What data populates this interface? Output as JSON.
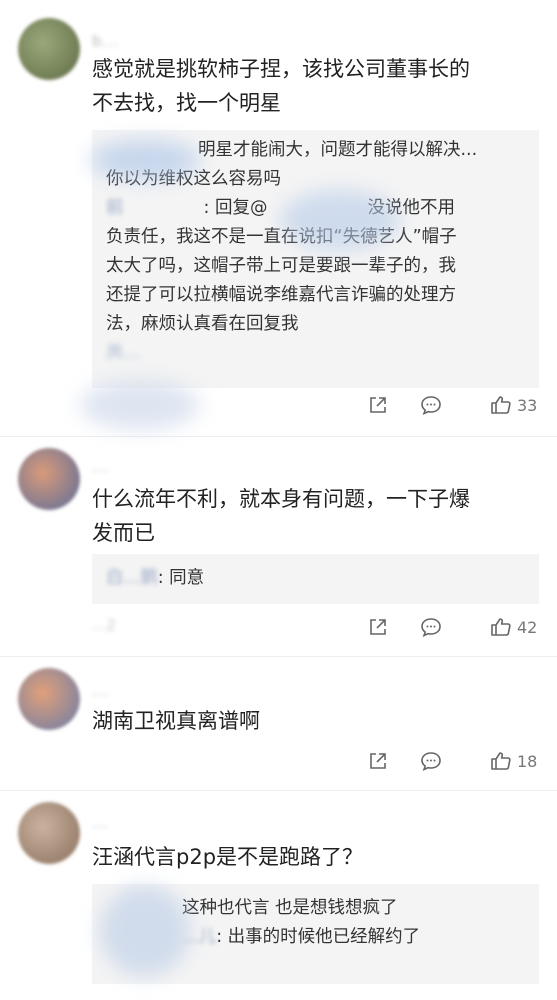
{
  "comments": [
    {
      "username": "b...",
      "text_lines": [
        "感觉就是挑软柿子捏，该找公司董事长的",
        "不去找，找一个明星"
      ],
      "reply_lines": [
        {
          "user": "",
          "text": "明星才能闹大，问题才能得以解决..."
        },
        {
          "user": "",
          "text": "你以为维权这么容易吗"
        },
        {
          "user": "前",
          "text": ": 回复@",
          "text2": "没说他不用"
        },
        {
          "user": "",
          "text": "负责任，我这不是一直在说扣“失德艺人”帽子"
        },
        {
          "user": "",
          "text": "太大了吗，这帽子带上可是要跟一辈子的，我"
        },
        {
          "user": "",
          "text": "还提了可以拉横幅说李维嘉代言诈骗的处理方"
        },
        {
          "user": "",
          "text": "法，麻烦认真看在回复我"
        }
      ],
      "more_text": "共...",
      "like_count": "33",
      "avatar_color": "#8a9a6a"
    },
    {
      "username": "...",
      "text_lines": [
        "什么流年不利，就本身有问题，一下子爆",
        "发而已"
      ],
      "reply_lines": [
        {
          "user": "白...鹅",
          "text": ": 同意"
        }
      ],
      "timestamp": "...2",
      "like_count": "42",
      "avatar_color": "#c07a5a"
    },
    {
      "username": "...",
      "text_lines": [
        "湖南卫视真离谱啊"
      ],
      "like_count": "18",
      "avatar_color": "#6a7ba8"
    },
    {
      "username": "...",
      "text_lines": [
        "汪涵代言p2p是不是跑路了？"
      ],
      "reply_lines": [
        {
          "user": "",
          "text": "这种也代言 也是想钱想疯了"
        },
        {
          "user": "...儿",
          "text": ": 出事的时候他已经解约了"
        }
      ],
      "avatar_color": "#b39a86"
    }
  ],
  "icons": {
    "forward": "share-square-icon",
    "comment": "comment-bubble-icon",
    "like": "thumbs-up-icon"
  }
}
